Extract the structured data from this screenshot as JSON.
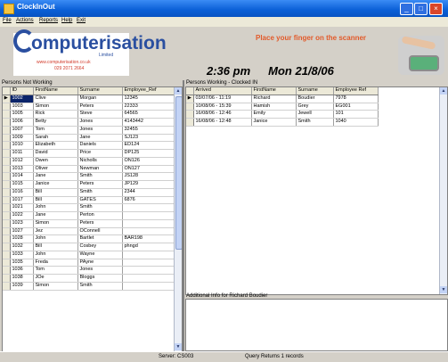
{
  "window": {
    "title": "ClockInOut"
  },
  "menu": [
    "File",
    "Actions",
    "Reports",
    "Help",
    "Exit"
  ],
  "logo": {
    "name": "omputerisation",
    "sub": "Limited",
    "url": "www.computerisation.co.uk",
    "phone": "029 2071 2664"
  },
  "prompt": "Place your finger on the scanner",
  "clock": {
    "time": "2:36 pm",
    "date": "Mon 21/8/06"
  },
  "not_working": {
    "caption": "Persons Not Working",
    "columns": [
      "ID",
      "FirstName",
      "Surname",
      "Employee_Ref"
    ],
    "rows": [
      [
        "1002",
        "Clive",
        "Morgan",
        "12345"
      ],
      [
        "1003",
        "Simon",
        "Peters",
        "22333"
      ],
      [
        "1005",
        "Rick",
        "Steve",
        "64565"
      ],
      [
        "1006",
        "Betty",
        "Jones",
        "4143442"
      ],
      [
        "1007",
        "Tom",
        "Jones",
        "32455"
      ],
      [
        "1009",
        "Sarah",
        "Jane",
        "SJ123"
      ],
      [
        "1010",
        "Elizabeth",
        "Daniels",
        "ED124"
      ],
      [
        "1011",
        "David",
        "Price",
        "DP125"
      ],
      [
        "1012",
        "Owen",
        "Nicholls",
        "ON126"
      ],
      [
        "1013",
        "Oliver",
        "Newman",
        "ON127"
      ],
      [
        "1014",
        "Jane",
        "Smith",
        "JS128"
      ],
      [
        "1015",
        "Janice",
        "Peters",
        "JP129"
      ],
      [
        "1016",
        "Bill",
        "Smith",
        "2344"
      ],
      [
        "1017",
        "Bill",
        "GATES",
        "6876"
      ],
      [
        "1021",
        "John",
        "Smith",
        ""
      ],
      [
        "1022",
        "Jane",
        "Perton",
        ""
      ],
      [
        "1023",
        "Simon",
        "Peters",
        ""
      ],
      [
        "1027",
        "Jez",
        "OConnell",
        ""
      ],
      [
        "1028",
        "John",
        "Bartlet",
        "BAR198"
      ],
      [
        "1032",
        "Bill",
        "Cosbey",
        "phngd"
      ],
      [
        "1033",
        "John",
        "Wayne",
        ""
      ],
      [
        "1035",
        "Freda",
        "PAyne",
        ""
      ],
      [
        "1036",
        "Tom",
        "Jones",
        ""
      ],
      [
        "1038",
        "JOe",
        "Bloggs",
        ""
      ],
      [
        "1039",
        "Simon",
        "Smith",
        ""
      ]
    ]
  },
  "working": {
    "caption": "Persons Working - Clocked IN",
    "columns": [
      "Arrived",
      "FirstName",
      "Surname",
      "Employee Ref"
    ],
    "rows": [
      [
        "03/07/06 - 11:19",
        "Richard",
        "Boudier",
        "7978"
      ],
      [
        "10/08/06 - 15:39",
        "Hamish",
        "Grey",
        "EG001"
      ],
      [
        "16/08/06 - 12:46",
        "Emily",
        "Jewell",
        "101"
      ],
      [
        "16/08/06 - 12:48",
        "Janice",
        "Smith",
        "1040"
      ]
    ]
  },
  "info": {
    "caption": "Additional Info for Richard Boudier"
  },
  "status": {
    "server": "Server: CS003",
    "query": "Query Returns 1 records"
  }
}
